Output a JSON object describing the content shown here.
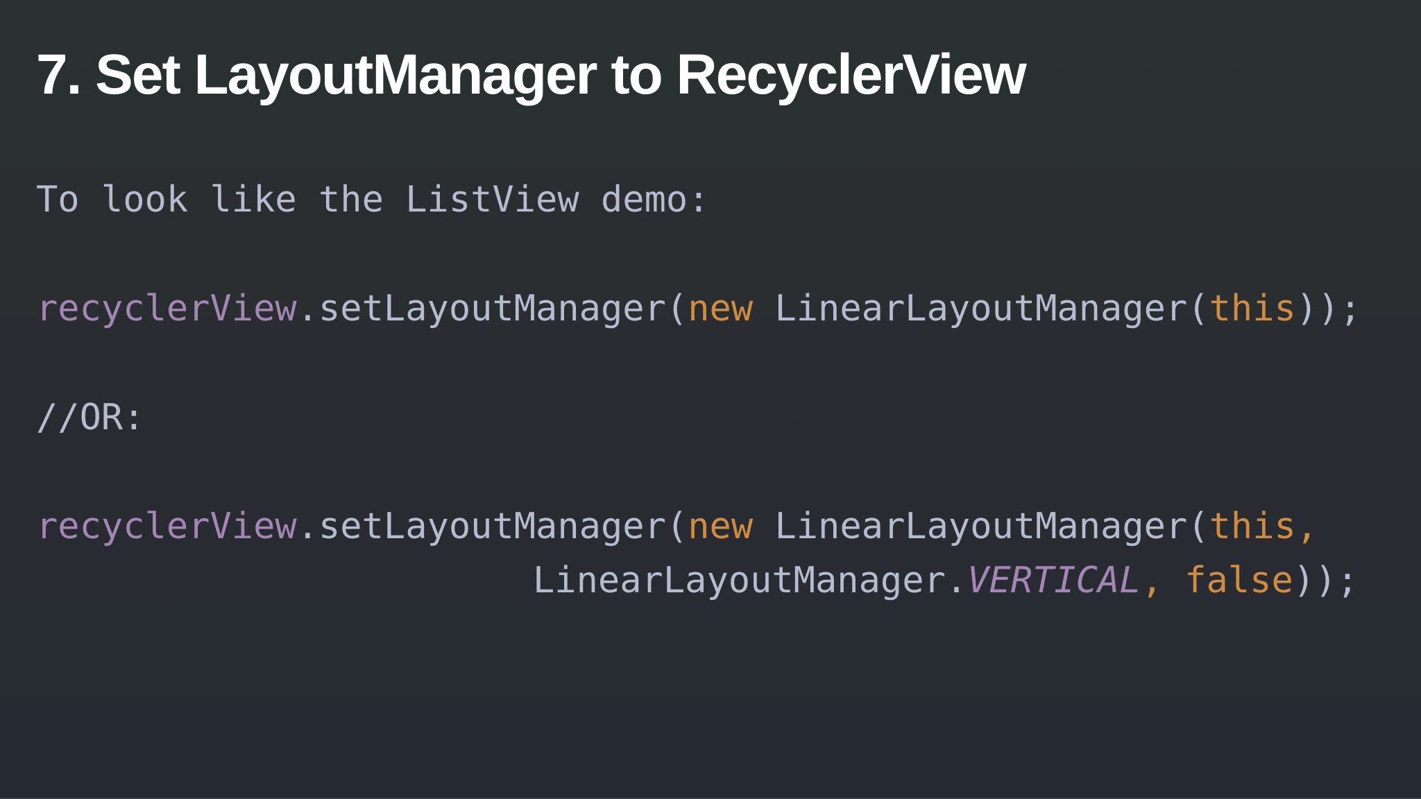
{
  "slide": {
    "title": "7. Set LayoutManager to RecyclerView",
    "intro": "To look like the ListView demo:",
    "code_line_1": {
      "receiver": "recyclerView",
      "call": ".setLayoutManager(",
      "kw_new": "new",
      "ctor": " LinearLayoutManager(",
      "kw_this": "this",
      "close": "));"
    },
    "comment": "//OR:",
    "code_line_2": {
      "receiver": "recyclerView",
      "call": ".setLayoutManager(",
      "kw_new": "new",
      "ctor": " LinearLayoutManager(",
      "kw_this": "this",
      "comma": ","
    },
    "code_line_3": {
      "class_ref": "LinearLayoutManager.",
      "constant": "VERTICAL",
      "comma": ", ",
      "kw_false": "false",
      "close": "));"
    }
  },
  "colors": {
    "background": "#292d31",
    "title": "#ffffff",
    "plain_code": "#b4bccd",
    "field": "#a486b5",
    "keyword": "#d08c3f"
  }
}
